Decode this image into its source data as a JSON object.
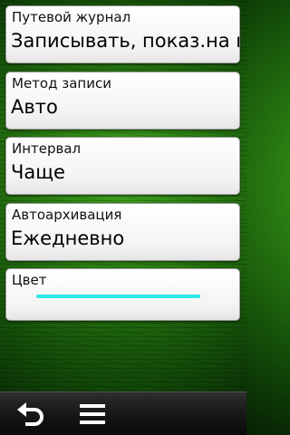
{
  "settings": [
    {
      "label": "Путевой журнал",
      "value": "Записывать, показ.на кар"
    },
    {
      "label": "Метод записи",
      "value": "Авто"
    },
    {
      "label": "Интервал",
      "value": "Чаще"
    },
    {
      "label": "Автоархивация",
      "value": "Ежедневно"
    },
    {
      "label": "Цвет",
      "swatch_color": "#2ee8e8"
    }
  ],
  "toolbar": {
    "back_icon": "back-arrow-icon",
    "menu_icon": "menu-icon"
  }
}
